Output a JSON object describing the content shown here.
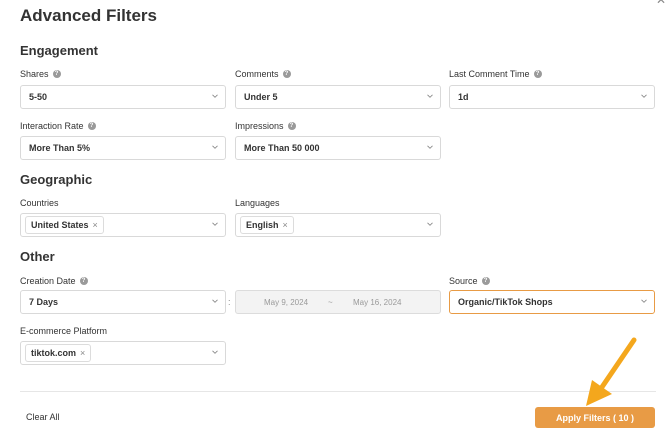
{
  "dialog": {
    "title": "Advanced Filters"
  },
  "sections": {
    "engagement": "Engagement",
    "geographic": "Geographic",
    "other": "Other"
  },
  "fields": {
    "shares": {
      "label": "Shares",
      "value": "5-50"
    },
    "comments": {
      "label": "Comments",
      "value": "Under 5"
    },
    "last_comment_time": {
      "label": "Last Comment Time",
      "value": "1d"
    },
    "interaction_rate": {
      "label": "Interaction Rate",
      "value": "More Than 5%"
    },
    "impressions": {
      "label": "Impressions",
      "value": "More Than 50 000"
    },
    "countries": {
      "label": "Countries",
      "tag": "United States"
    },
    "languages": {
      "label": "Languages",
      "tag": "English"
    },
    "creation_date": {
      "label": "Creation Date",
      "value": "7 Days",
      "from": "May 9, 2024",
      "sep": "~",
      "to": "May 16, 2024",
      "colon": ":"
    },
    "source": {
      "label": "Source",
      "value": "Organic/TikTok Shops"
    },
    "ecommerce_platform": {
      "label": "E-commerce Platform",
      "tag": "tiktok.com"
    }
  },
  "footer": {
    "clear_all": "Clear All",
    "apply": "Apply Filters ( 10 )"
  },
  "icons": {
    "help": "question-circle-icon",
    "chevron": "chevron-down-icon",
    "remove": "close-icon"
  },
  "colors": {
    "accent": "#e89b45",
    "annotation_arrow": "#f4a71d"
  }
}
